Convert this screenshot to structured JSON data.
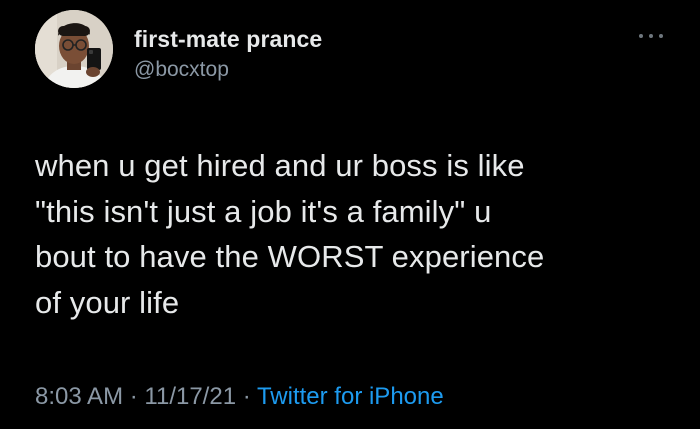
{
  "tweet": {
    "display_name": "first-mate prance",
    "handle": "@bocxtop",
    "text_lines": [
      "when u get hired and ur boss is like",
      "\"this isn't just a job it's a family\" u",
      "bout to have the WORST experience",
      "of your life"
    ],
    "time": "8:03 AM",
    "separator": "·",
    "date": "11/17/21",
    "source": "Twitter for iPhone"
  },
  "icons": {
    "more": "more-horizontal-icon",
    "avatar": "profile-photo"
  },
  "colors": {
    "background": "#000000",
    "primary_text": "#e7e9ea",
    "secondary_text": "#8b98a5",
    "link": "#1d9bf0"
  }
}
